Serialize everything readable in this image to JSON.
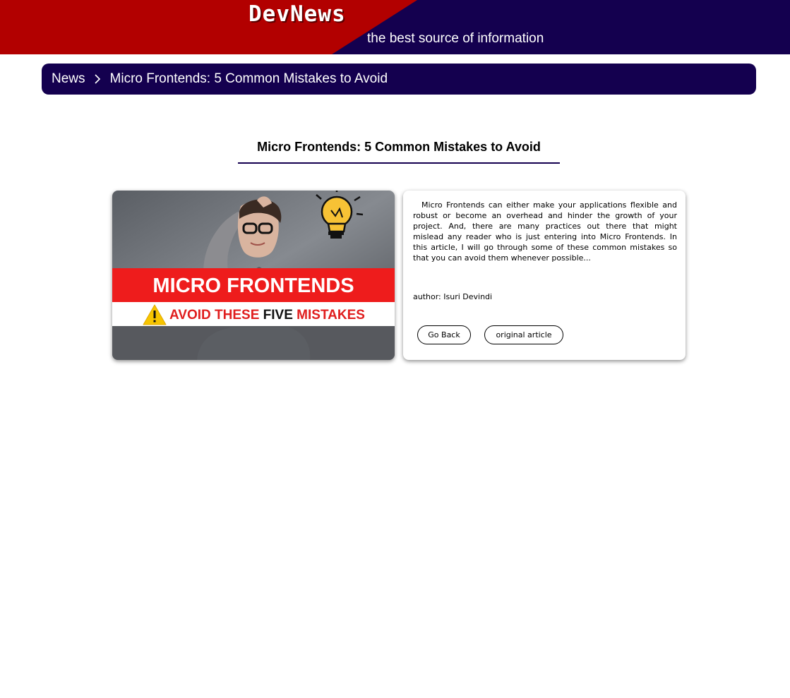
{
  "header": {
    "logo": "DevNews",
    "tagline": "the best source of information",
    "colors": {
      "red": "#b20000",
      "navy": "#14004f"
    }
  },
  "breadcrumb": {
    "root_label": "News",
    "separator_icon": "chevron-right-icon",
    "current_label": "Micro Frontends: 5 Common Mistakes to Avoid"
  },
  "article": {
    "title": "Micro Frontends: 5 Common Mistakes to Avoid",
    "image": {
      "banner_text": "MICRO FRONTENDS",
      "subtitle_start": "AVOID THESE ",
      "subtitle_bold": "FIVE",
      "subtitle_end": " MISTAKES",
      "warning_icon": "warning-icon",
      "bulb_icon": "lightbulb-icon",
      "colors": {
        "banner": "#ee1c1c",
        "subtitle": "#e01e1e",
        "warning": "#f7c500"
      }
    },
    "summary": "Micro Frontends can either make your applications flexible and robust or become an overhead and hinder the growth of your project. And, there are many practices out there that might mislead any reader who is just entering into Micro Frontends. In this article, I will go through some of these common mistakes so that you can avoid them whenever possible...",
    "author": "author: Isuri Devindi",
    "buttons": {
      "back": "Go Back",
      "original": "original article"
    }
  }
}
